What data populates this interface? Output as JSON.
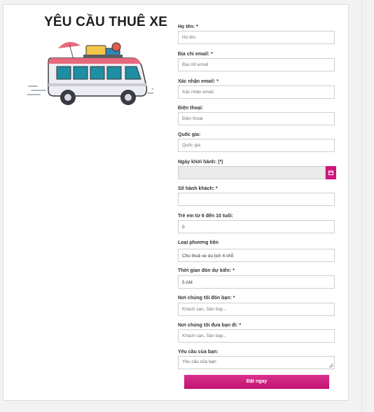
{
  "page": {
    "title": "YÊU CẦU THUÊ XE"
  },
  "form": {
    "full_name": {
      "label": "Họ tên: *",
      "placeholder": "Họ tên"
    },
    "email": {
      "label": "Địa chỉ email: *",
      "placeholder": "Địa chỉ email"
    },
    "email_confirm": {
      "label": "Xác nhận email: *",
      "placeholder": "Xác nhận email"
    },
    "phone": {
      "label": "Điện thoại:",
      "placeholder": "Điện thoại"
    },
    "country": {
      "label": "Quốc gia:",
      "placeholder": "Quốc gia"
    },
    "departure_date": {
      "label": "Ngày khởi hành: (*)",
      "value": ""
    },
    "passengers": {
      "label": "Số hành khách: *",
      "value": ""
    },
    "children": {
      "label": "Trẻ em từ 6 đến 10 tuổi:",
      "value": "0"
    },
    "vehicle_type": {
      "label": "Loại phương tiện",
      "value": "Cho thuê xe du lịch 4 chỗ"
    },
    "pickup_time": {
      "label": "Thời gian đón dự kiến: *",
      "value": "5 AM"
    },
    "pickup_place": {
      "label": "Nơi chúng tôi đón bạn: *",
      "placeholder": "Khách sạn, Sân bay..."
    },
    "dropoff_place": {
      "label": "Nơi chúng tôi đưa bạn đi: *",
      "placeholder": "Khách sạn, Sân bay..."
    },
    "request": {
      "label": "Yêu cầu của bạn:",
      "placeholder": "Yêu cầu của bạn"
    },
    "submit_label": "Đặt ngay"
  },
  "colors": {
    "accent": "#d2157c",
    "van_teal": "#1e8fa3",
    "van_body": "#ececf4"
  },
  "icons": {
    "calendar": "calendar-icon",
    "illustration": "van-illustration"
  }
}
